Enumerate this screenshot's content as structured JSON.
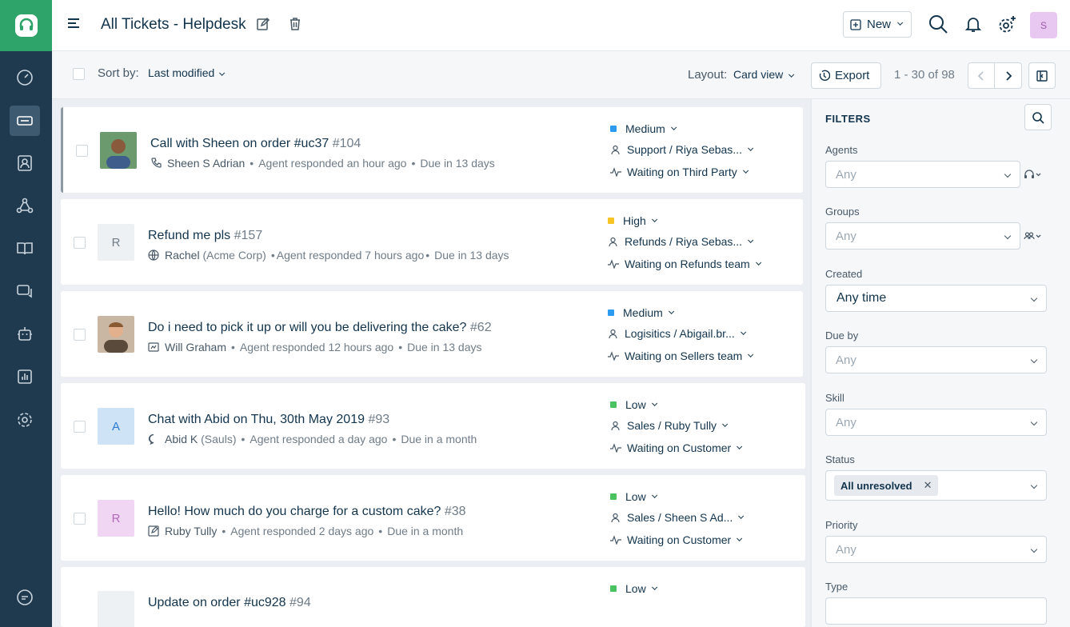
{
  "header": {
    "title": "All Tickets - Helpdesk",
    "new_label": "New",
    "avatar_initial": "S"
  },
  "toolbar": {
    "sort_label": "Sort by:",
    "sort_value": "Last modified",
    "layout_label": "Layout:",
    "layout_value": "Card view",
    "export_label": "Export",
    "pagination": "1 - 30 of 98"
  },
  "tickets": [
    {
      "subject": "Call with Sheen on order #uc37",
      "number": "#104",
      "requester": "Sheen S Adrian",
      "org": "",
      "activity": "Agent responded an hour ago",
      "due": "Due in 13 days",
      "priority": "Medium",
      "priority_color": "#2c9bf0",
      "assignment": "Support / Riya Sebas...",
      "status": "Waiting on Third Party",
      "avatar_letter": "",
      "avatar_bg": "#4f7a52"
    },
    {
      "subject": "Refund me pls",
      "number": "#157",
      "requester": "Rachel",
      "org": "(Acme Corp)",
      "activity": "Agent responded 7 hours ago",
      "due": "Due in 13 days",
      "priority": "High",
      "priority_color": "#f7c425",
      "assignment": "Refunds / Riya Sebas...",
      "status": "Waiting on Refunds team",
      "avatar_letter": "R",
      "avatar_bg": "#eef1f3"
    },
    {
      "subject": "Do i need to pick it up or will you be delivering the cake?",
      "number": "#62",
      "requester": "Will Graham",
      "org": "",
      "activity": "Agent responded 12 hours ago",
      "due": "Due in 13 days",
      "priority": "Medium",
      "priority_color": "#2c9bf0",
      "assignment": "Logisitics / Abigail.br...",
      "status": "Waiting on Sellers team",
      "avatar_letter": "",
      "avatar_bg": "#b89a7e"
    },
    {
      "subject": "Chat with Abid on Thu, 30th May 2019",
      "number": "#93",
      "requester": "Abid K",
      "org": "(Sauls)",
      "activity": "Agent responded a day ago",
      "due": "Due in a month",
      "priority": "Low",
      "priority_color": "#4ac25f",
      "assignment": "Sales / Ruby Tully",
      "status": "Waiting on Customer",
      "avatar_letter": "A",
      "avatar_bg": "#cfe3f7"
    },
    {
      "subject": "Hello! How much do you charge for a custom cake?",
      "number": "#38",
      "requester": "Ruby Tully",
      "org": "",
      "activity": "Agent responded 2 days ago",
      "due": "Due in a month",
      "priority": "Low",
      "priority_color": "#4ac25f",
      "assignment": "Sales / Sheen S Ad...",
      "status": "Waiting on Customer",
      "avatar_letter": "R",
      "avatar_bg": "#f1d6f3"
    },
    {
      "subject": "Update on order #uc928",
      "number": "#94",
      "requester": "",
      "org": "",
      "activity": "",
      "due": "",
      "priority": "Low",
      "priority_color": "#4ac25f",
      "assignment": "",
      "status": "",
      "avatar_letter": "",
      "avatar_bg": "#eef1f3"
    }
  ],
  "filters": {
    "title": "FILTERS",
    "agents_label": "Agents",
    "agents_value": "Any",
    "groups_label": "Groups",
    "groups_value": "Any",
    "created_label": "Created",
    "created_value": "Any time",
    "due_label": "Due by",
    "due_value": "Any",
    "skill_label": "Skill",
    "skill_value": "Any",
    "status_label": "Status",
    "status_chip": "All unresolved",
    "priority_label": "Priority",
    "priority_value": "Any",
    "type_label": "Type"
  }
}
